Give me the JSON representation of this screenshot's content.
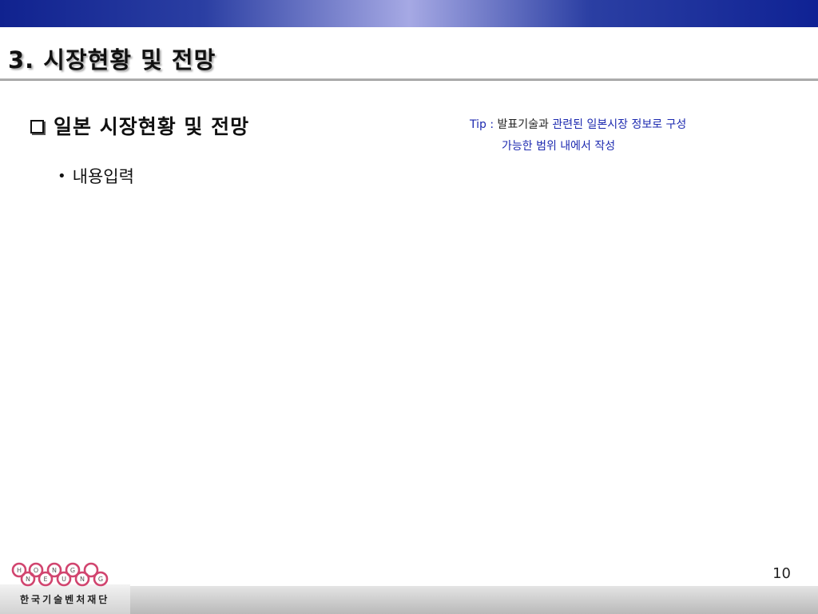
{
  "slide": {
    "title": "3. 시장현황 및 전망",
    "heading": "일본 시장현황 및 전망",
    "bullet": "내용입력",
    "tip": {
      "label": "Tip :",
      "dark_part": "발표기술과",
      "blue_part": "관련된 일본시장 정보로 구성",
      "line2": "가능한 범위 내에서 작성"
    },
    "page_number": "10"
  },
  "logo": {
    "letters_top": [
      "H",
      "O",
      "N",
      "G"
    ],
    "letters_bottom": [
      "N",
      "E",
      "U",
      "N",
      "G"
    ],
    "caption": "한국기술벤처재단",
    "colors": {
      "pink": "#d1456f",
      "gray": "#555555"
    }
  },
  "colors": {
    "band_dark": "#10228f",
    "band_light": "#a6a9e4",
    "tip_blue": "#1d2ab0"
  }
}
